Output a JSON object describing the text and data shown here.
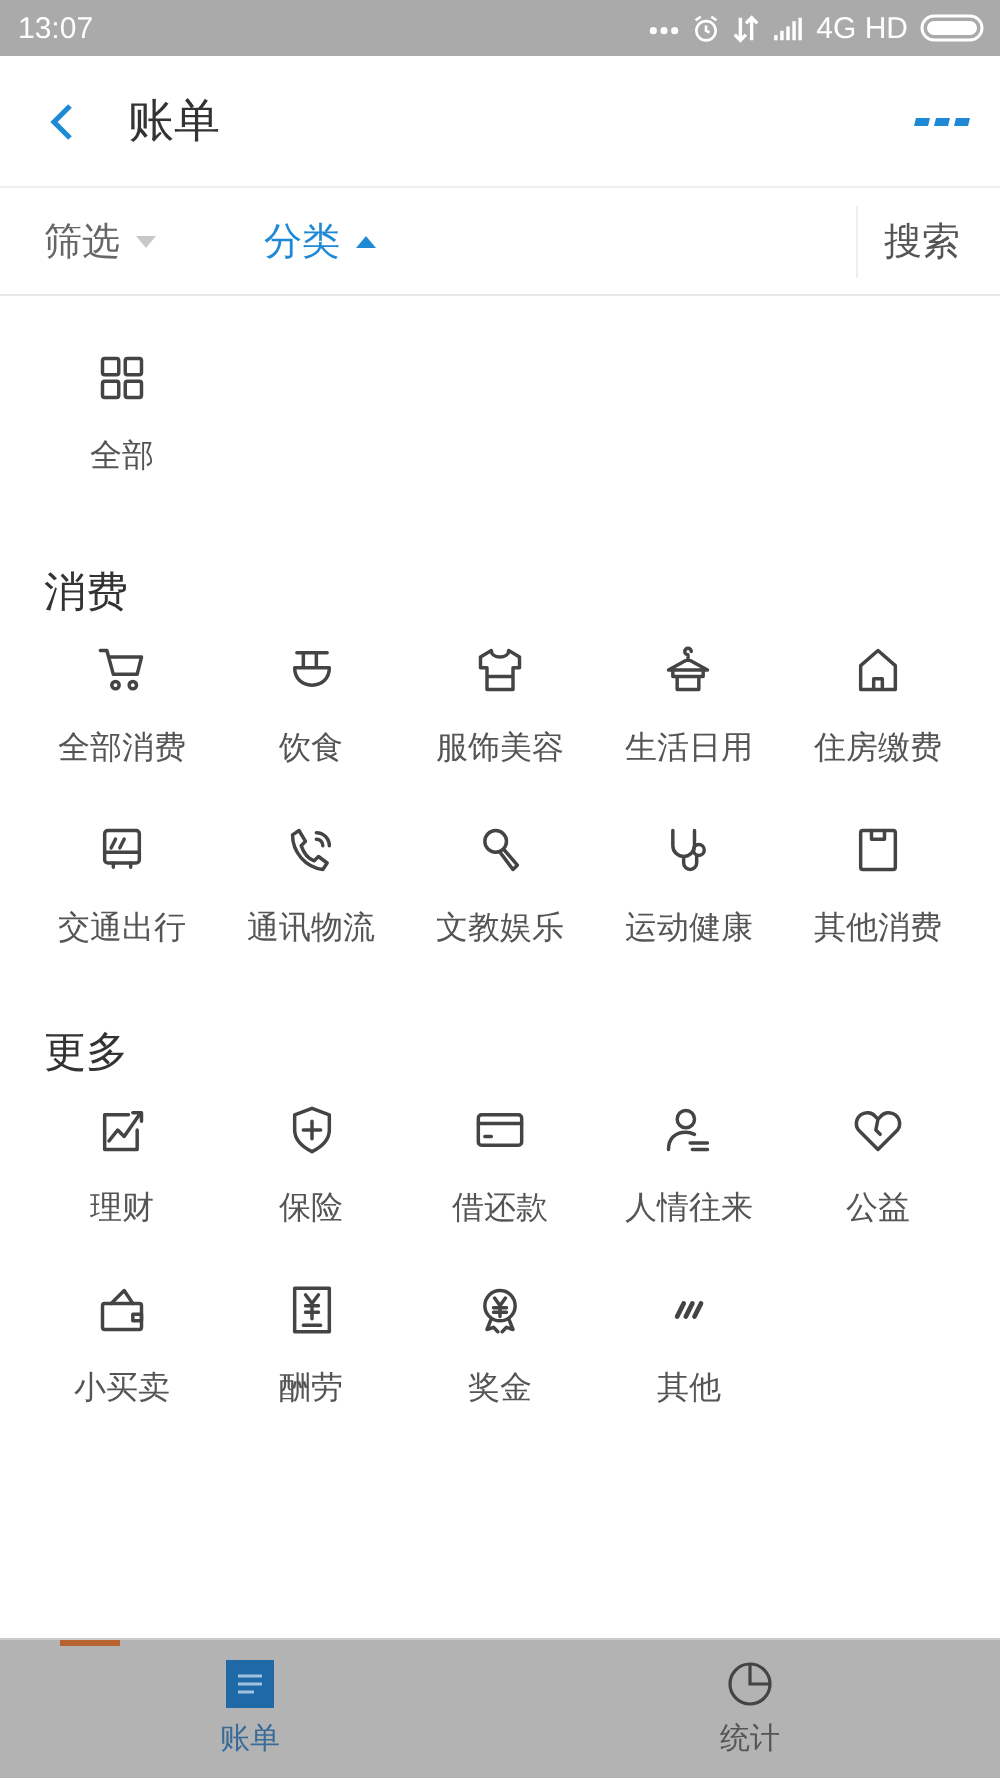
{
  "status_bar": {
    "time": "13:07",
    "network": "4G HD"
  },
  "header": {
    "title": "账单"
  },
  "filter_bar": {
    "options": [
      {
        "label": "筛选",
        "selected": false
      },
      {
        "label": "分类",
        "selected": true
      }
    ],
    "search": "搜索"
  },
  "all_item": {
    "label": "全部"
  },
  "sections": [
    {
      "title": "消费",
      "items": [
        {
          "label": "全部消费"
        },
        {
          "label": "饮食"
        },
        {
          "label": "服饰美容"
        },
        {
          "label": "生活日用"
        },
        {
          "label": "住房缴费"
        },
        {
          "label": "交通出行"
        },
        {
          "label": "通讯物流"
        },
        {
          "label": "文教娱乐"
        },
        {
          "label": "运动健康"
        },
        {
          "label": "其他消费"
        }
      ]
    },
    {
      "title": "更多",
      "items": [
        {
          "label": "理财"
        },
        {
          "label": "保险"
        },
        {
          "label": "借还款"
        },
        {
          "label": "人情往来"
        },
        {
          "label": "公益"
        },
        {
          "label": "小买卖"
        },
        {
          "label": "酬劳"
        },
        {
          "label": "奖金"
        },
        {
          "label": "其他"
        }
      ]
    }
  ],
  "tab_bar": [
    {
      "label": "账单",
      "selected": true
    },
    {
      "label": "统计",
      "selected": false
    }
  ]
}
